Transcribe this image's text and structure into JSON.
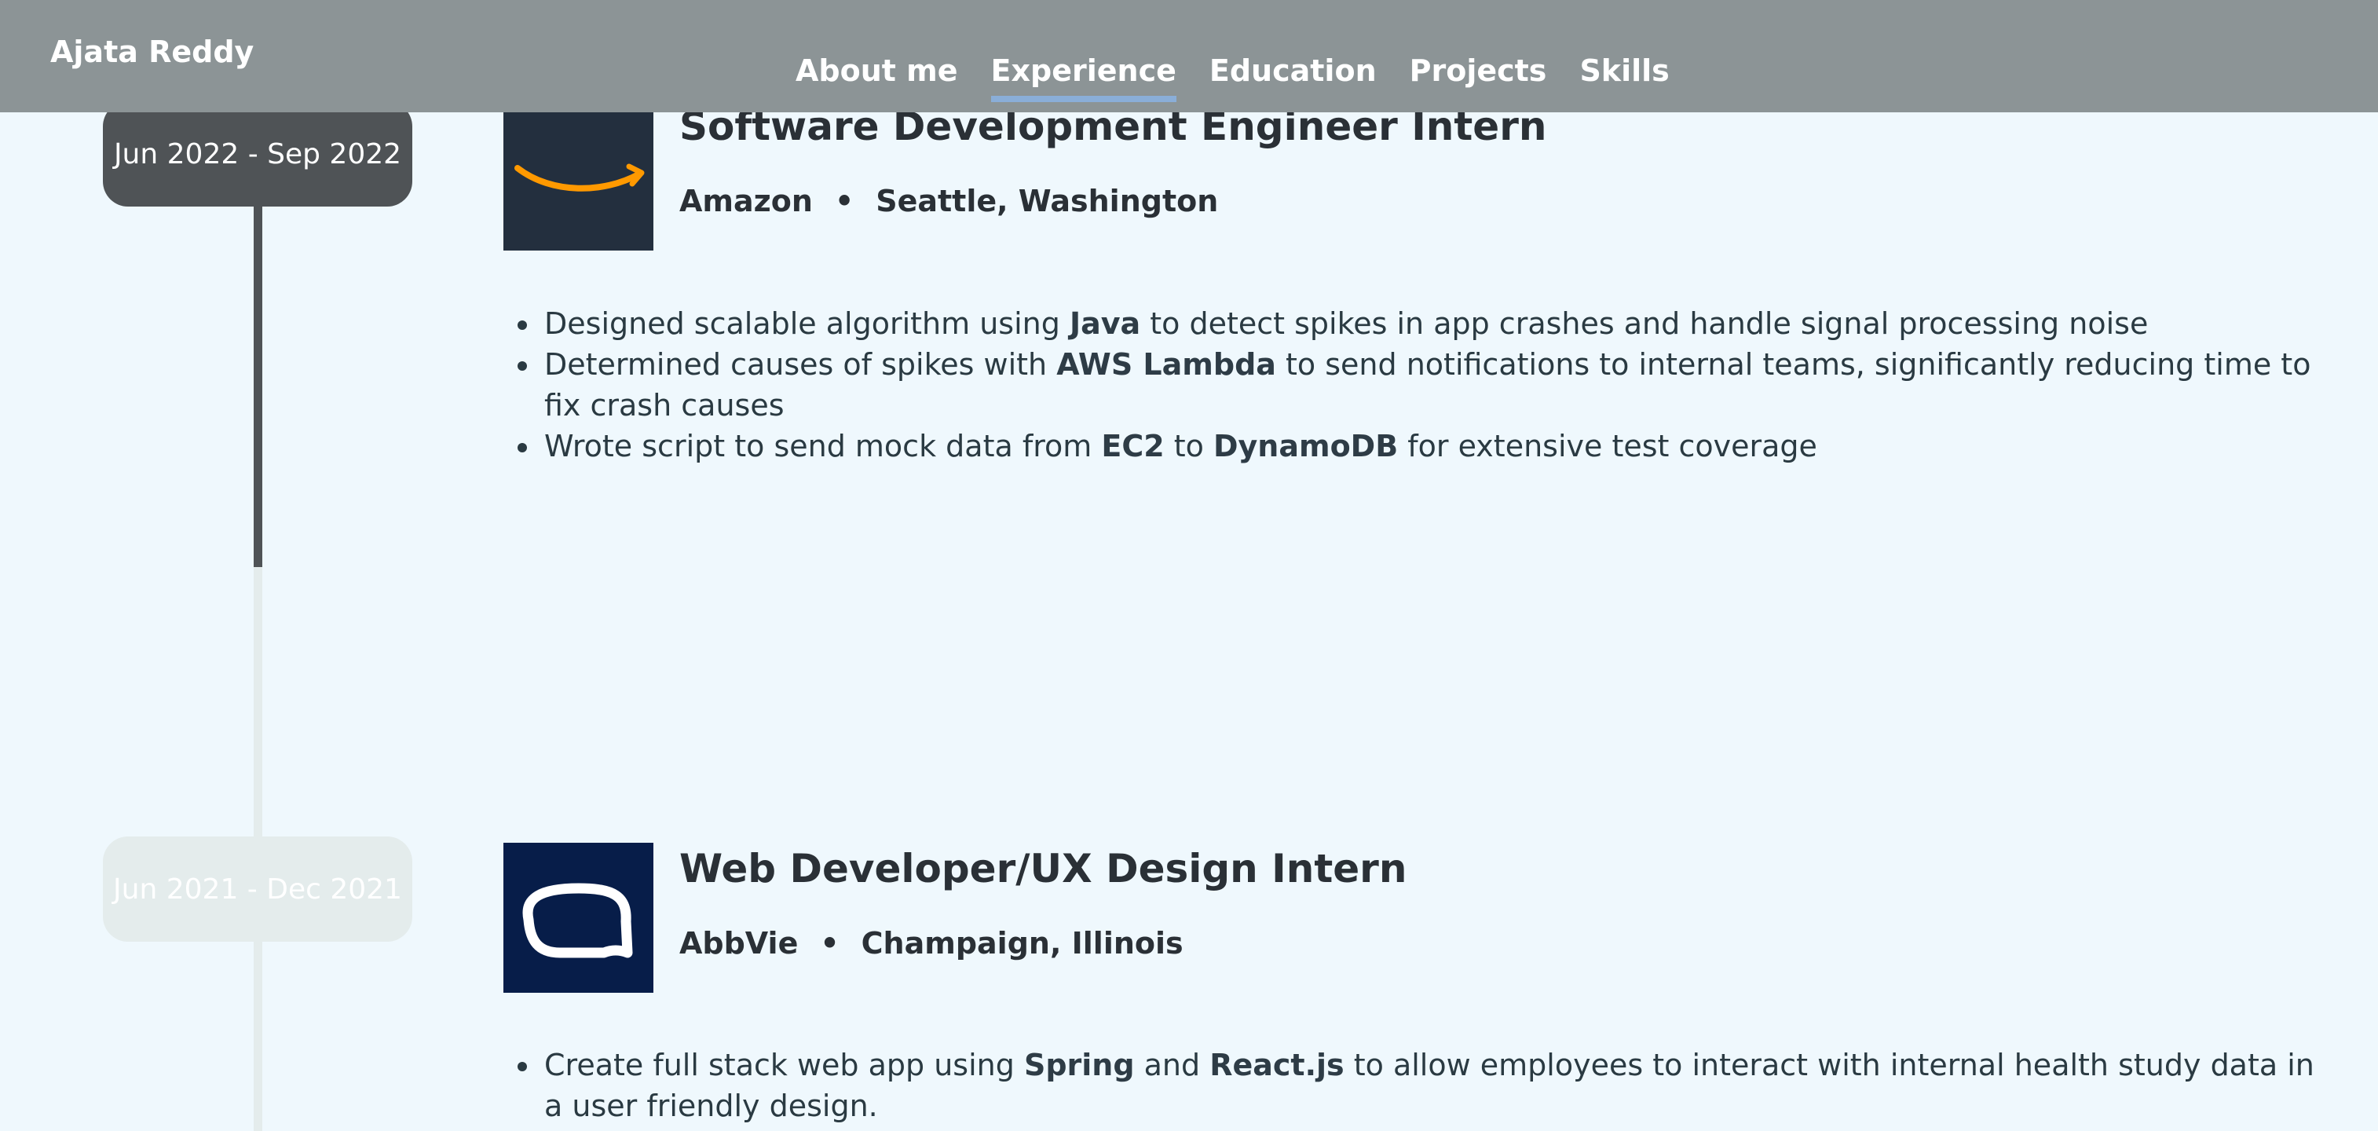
{
  "navbar": {
    "brand": "Ajata Reddy",
    "links": [
      {
        "label": "About me"
      },
      {
        "label": "Experience",
        "active": true
      },
      {
        "label": "Education"
      },
      {
        "label": "Projects"
      },
      {
        "label": "Skills"
      }
    ]
  },
  "experience": [
    {
      "date": "Jun 2022 - Sep 2022",
      "title": "Software Development Engineer Intern",
      "company": "Amazon",
      "location": "Seattle, Washington",
      "separator": "•",
      "bullets": [
        {
          "parts": [
            "Designed scalable algorithm using ",
            "Java",
            " to detect spikes in app crashes and handle signal processing noise"
          ]
        },
        {
          "parts": [
            "Determined causes of spikes with ",
            "AWS Lambda",
            " to send notifications to internal teams, significantly reducing time to fix crash causes"
          ]
        },
        {
          "parts": [
            "Wrote script to send mock data from ",
            "EC2",
            " to ",
            "DynamoDB",
            " for extensive test coverage"
          ]
        }
      ]
    },
    {
      "date": "Jun 2021 - Dec 2021",
      "title": "Web Developer/UX Design Intern",
      "company": "AbbVie",
      "location": "Champaign, Illinois",
      "separator": "•",
      "bullets": [
        {
          "parts": [
            "Create full stack web app using ",
            "Spring",
            " and ",
            "React.js",
            " to allow employees to interact with internal health study data in a user friendly design."
          ]
        }
      ]
    }
  ],
  "colors": {
    "navbar": "#8c9496",
    "background": "#eff8fd",
    "timeline_active": "#4f5356",
    "timeline_inactive": "#e4ecec",
    "nav_underline": "#8aaed8",
    "amazon_logo_bg": "#232f3e",
    "amazon_smile": "#ff9900",
    "abbvie_logo_bg": "#071d49"
  }
}
